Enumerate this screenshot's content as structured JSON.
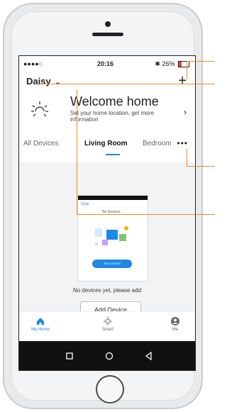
{
  "status": {
    "carrier": "●●●●○  ",
    "time": "20:16",
    "right": "26%"
  },
  "header": {
    "username": "Daisy",
    "user_chevron": "⌄",
    "plus": "+"
  },
  "welcome": {
    "title": "Welcome home",
    "subtitle": "Set your home location, get more information",
    "chevron": "›"
  },
  "tabs": [
    {
      "label": "All Devices"
    },
    {
      "label": "Living Room"
    },
    {
      "label": "Bedroom"
    }
  ],
  "more": "•••",
  "content": {
    "preview": {
      "brand": "Ocity",
      "title": "No Devices",
      "button": "ADD DEVICE"
    },
    "empty_text": "No devices yet, please add",
    "add_button": "Add Device"
  },
  "bottom_nav": [
    {
      "label": "My Home",
      "icon": "house-icon"
    },
    {
      "label": "Smart",
      "icon": "sun-icon"
    },
    {
      "label": "Me",
      "icon": "person-icon"
    }
  ],
  "android_nav": {
    "back_icon": "triangle-back-icon",
    "home_icon": "circle-home-icon",
    "recent_icon": "square-recent-icon"
  },
  "colors": {
    "accent": "#1e88e5",
    "callout": "#f08a24"
  }
}
